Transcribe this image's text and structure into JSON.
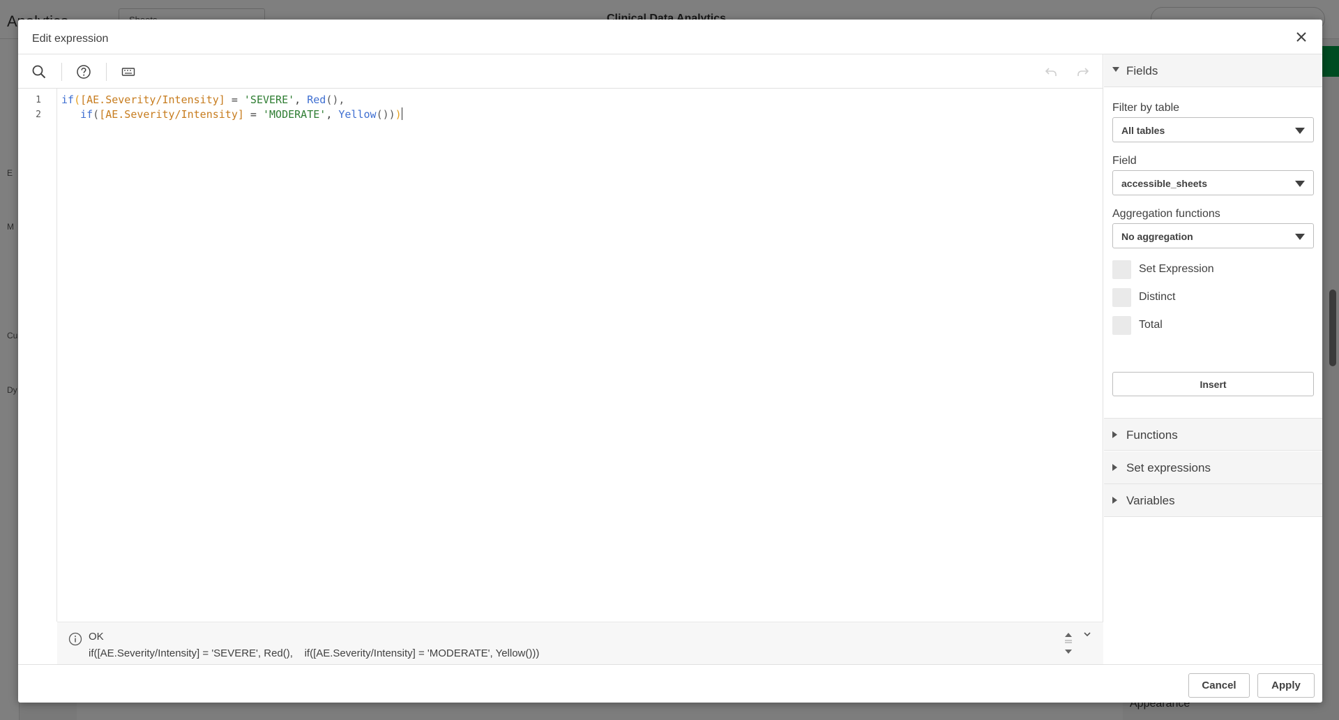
{
  "background": {
    "app_title": "Analytics",
    "sheet_button": "Sheets",
    "center_title": "Clinical Data Analytics",
    "left_labels": [
      "E",
      "M",
      "Cu",
      "Dy"
    ],
    "appearance_label": "Appearance"
  },
  "dialog": {
    "title": "Edit expression",
    "close_icon": "close-icon"
  },
  "toolbar": {
    "search_icon": "search-icon",
    "help_icon": "help-circle-icon",
    "keyboard_icon": "keyboard-icon",
    "undo_icon": "undo-icon",
    "redo_icon": "redo-icon"
  },
  "editor": {
    "line_numbers": [
      "1",
      "2"
    ],
    "line1": {
      "t1": "if",
      "t2": "(",
      "t3": "[AE.Severity/Intensity]",
      "t4": " = ",
      "t5": "'SEVERE'",
      "t6": ", ",
      "t7": "Red",
      "t8": "(),"
    },
    "line2": {
      "t0": "   ",
      "t1": "if",
      "t2": "(",
      "t3": "[AE.Severity/Intensity]",
      "t4": " = ",
      "t5": "'MODERATE'",
      "t6": ", ",
      "t7": "Yellow",
      "t8": "())",
      "t9": ")"
    }
  },
  "status": {
    "state": "OK",
    "expression": "if([AE.Severity/Intensity] = 'SEVERE', Red(),    if([AE.Severity/Intensity] = 'MODERATE', Yellow()))"
  },
  "sidebar": {
    "fields_header": "Fields",
    "filter_label": "Filter by table",
    "filter_value": "All tables",
    "field_label": "Field",
    "field_value": "accessible_sheets",
    "aggregation_label": "Aggregation functions",
    "aggregation_value": "No aggregation",
    "checkboxes": [
      "Set Expression",
      "Distinct",
      "Total"
    ],
    "insert_label": "Insert",
    "sections": [
      "Functions",
      "Set expressions",
      "Variables"
    ]
  },
  "footer": {
    "cancel_label": "Cancel",
    "apply_label": "Apply"
  },
  "colors": {
    "function": "#3f6fd1",
    "field": "#c77c1e",
    "string": "#2e7d32",
    "bracket_highlight": "#e6a020",
    "accent_green": "#009845"
  }
}
